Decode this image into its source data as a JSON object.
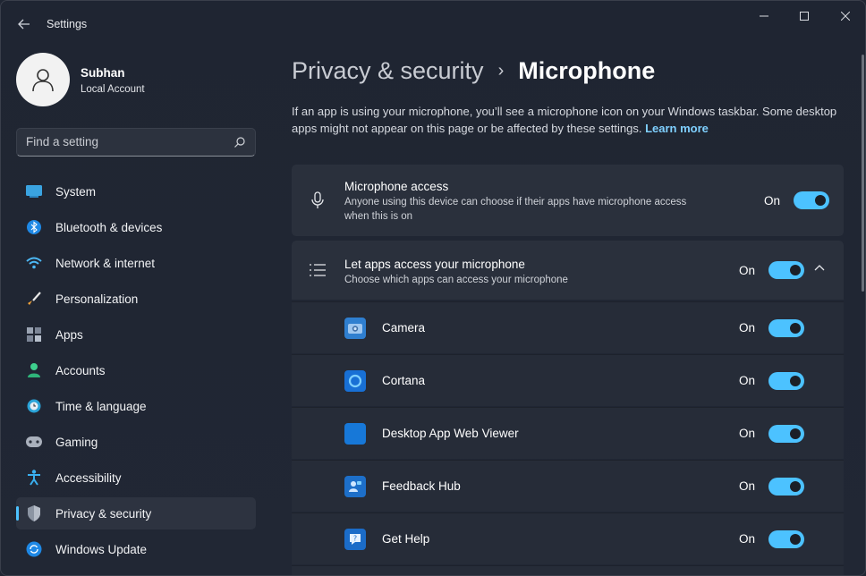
{
  "window": {
    "title": "Settings"
  },
  "profile": {
    "name": "Subhan",
    "account_type": "Local Account"
  },
  "search": {
    "placeholder": "Find a setting"
  },
  "nav": [
    {
      "label": "System",
      "icon": "monitor-icon",
      "active": false
    },
    {
      "label": "Bluetooth & devices",
      "icon": "bluetooth-icon",
      "active": false
    },
    {
      "label": "Network & internet",
      "icon": "wifi-icon",
      "active": false
    },
    {
      "label": "Personalization",
      "icon": "brush-icon",
      "active": false
    },
    {
      "label": "Apps",
      "icon": "apps-icon",
      "active": false
    },
    {
      "label": "Accounts",
      "icon": "person-icon",
      "active": false
    },
    {
      "label": "Time & language",
      "icon": "globe-clock-icon",
      "active": false
    },
    {
      "label": "Gaming",
      "icon": "gamepad-icon",
      "active": false
    },
    {
      "label": "Accessibility",
      "icon": "accessibility-icon",
      "active": false
    },
    {
      "label": "Privacy & security",
      "icon": "shield-icon",
      "active": true
    },
    {
      "label": "Windows Update",
      "icon": "update-icon",
      "active": false
    }
  ],
  "breadcrumb": {
    "parent": "Privacy & security",
    "separator": "›",
    "current": "Microphone"
  },
  "description": {
    "text": "If an app is using your microphone, you’ll see a microphone icon on your Windows taskbar. Some desktop apps might not appear on this page or be affected by these settings.",
    "link": "Learn more"
  },
  "microphone_access": {
    "title": "Microphone access",
    "subtitle": "Anyone using this device can choose if their apps have microphone access when this is on",
    "state": "On"
  },
  "apps_access": {
    "title": "Let apps access your microphone",
    "subtitle": "Choose which apps can access your microphone",
    "state": "On"
  },
  "apps": [
    {
      "name": "Camera",
      "state": "On",
      "icon": "camera-app-icon"
    },
    {
      "name": "Cortana",
      "state": "On",
      "icon": "cortana-app-icon"
    },
    {
      "name": "Desktop App Web Viewer",
      "state": "On",
      "icon": "web-viewer-app-icon"
    },
    {
      "name": "Feedback Hub",
      "state": "On",
      "icon": "feedback-hub-app-icon"
    },
    {
      "name": "Get Help",
      "state": "On",
      "icon": "get-help-app-icon"
    }
  ],
  "colors": {
    "accent": "#4cc2ff",
    "link": "#7fd0ff",
    "background": "#202633",
    "card": "#2a303c"
  }
}
